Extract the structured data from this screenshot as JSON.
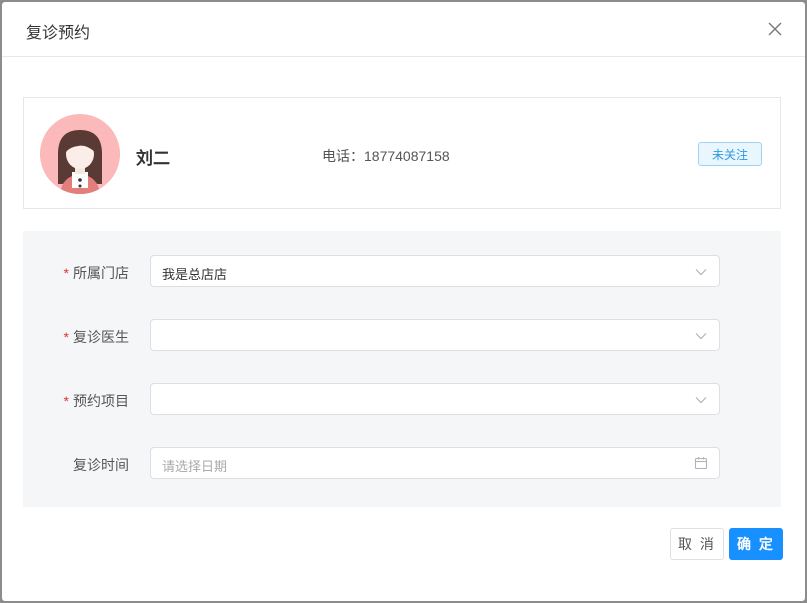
{
  "dialog": {
    "title": "复诊预约",
    "close_icon": "close-icon"
  },
  "patient": {
    "name": "刘二",
    "phone_label": "电话：",
    "phone": "18774087158",
    "follow_status": "未关注",
    "avatar_icon": "female-avatar-icon"
  },
  "form": {
    "store": {
      "label": "所属门店",
      "required": true,
      "value": "我是总店店"
    },
    "doctor": {
      "label": "复诊医生",
      "required": true,
      "value": ""
    },
    "project": {
      "label": "预约项目",
      "required": true,
      "value": ""
    },
    "date": {
      "label": "复诊时间",
      "required": false,
      "placeholder": "请选择日期"
    }
  },
  "footer": {
    "cancel_label": "取 消",
    "ok_label": "确 定"
  },
  "colors": {
    "primary": "#1890ff",
    "required_mark": "#e0362f",
    "panel_bg": "#f5f6f8"
  }
}
